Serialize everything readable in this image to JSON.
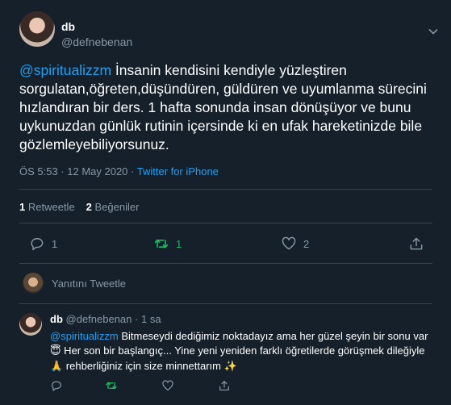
{
  "tweet": {
    "author_name": "db",
    "author_handle": "@defnebenan",
    "mention": "@spiritualizzm",
    "text": " İnsanin kendisini kendiyle yüzleştiren sorgulatan,öğreten,düşündüren, güldüren ve uyumlanma sürecini hızlandıran bir ders. 1 hafta sonunda  insan dönüşüyor ve bunu uykunuzdan günlük rutinin içersinde ki en ufak hareketinizde bile gözlemleyebiliyorsunuz.",
    "timestamp": "ÖS 5:53 · 12 May 2020",
    "meta_separator": " · ",
    "source": "Twitter for iPhone"
  },
  "stats": {
    "retweet_count": "1",
    "retweet_label": "Retweetle",
    "like_count": "2",
    "like_label": "Beğeniler"
  },
  "actions": {
    "reply_count": "1",
    "retweet_count": "1",
    "like_count": "2"
  },
  "reply_box": {
    "placeholder": "Yanıtını Tweetle"
  },
  "reply": {
    "author_name": "db",
    "author_handle": "@defnebenan",
    "time": "· 1 sa",
    "mention": "@spiritualizzm",
    "text_1": " Bitmeseydi dediğimiz noktadayız ama her güzel şeyin bir sonu var ",
    "emoji_1": "😇",
    "text_2": " Her son bir başlangıç... Yine yeni yeniden farklı öğretilerde görüşmek dileğiyle ",
    "emoji_2": "🙏",
    "text_3": " rehberliğiniz için size minnettarım ",
    "emoji_3": "✨"
  },
  "colors": {
    "background": "#15202b",
    "accent": "#1da1f2",
    "muted": "#8899a6",
    "retweet": "#17bf63",
    "divider": "#38444d"
  },
  "icons": [
    "chevron-down-icon",
    "reply-icon",
    "retweet-icon",
    "like-icon",
    "share-icon"
  ]
}
